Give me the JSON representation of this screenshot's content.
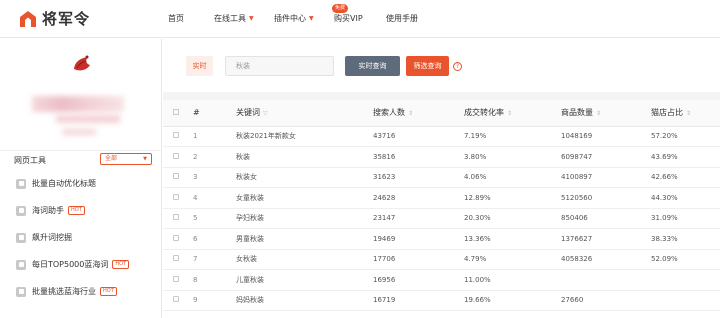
{
  "app": {
    "name": "将军令"
  },
  "nav": [
    {
      "label": "首页",
      "caret": false,
      "badge": ""
    },
    {
      "label": "在线工具",
      "caret": true,
      "badge": ""
    },
    {
      "label": "插件中心",
      "caret": true,
      "badge": "免费"
    },
    {
      "label": "购买VIP",
      "caret": false,
      "badge": ""
    },
    {
      "label": "使用手册",
      "caret": false,
      "badge": ""
    }
  ],
  "sidebar": {
    "tools_title": "网页工具",
    "tools_filter": "全部",
    "items": [
      {
        "label": "批量自动优化标题",
        "hot": ""
      },
      {
        "label": "海词助手",
        "hot": "HOT"
      },
      {
        "label": "飙升词挖掘",
        "hot": ""
      },
      {
        "label": "每日TOP5000蓝海词",
        "hot": "HOT"
      },
      {
        "label": "批量挑选蓝海行业",
        "hot": "HOT"
      }
    ]
  },
  "search": {
    "tab_label": "实时",
    "input_value": "秋装",
    "query_button": "实时查询",
    "filter_button": "筛选查询",
    "help_icon": "question-circle-icon"
  },
  "table": {
    "headers": [
      "#",
      "关键词",
      "搜索人数",
      "成交转化率",
      "商品数量",
      "猫店占比"
    ],
    "rows": [
      [
        "1",
        "秋装2021年新款女",
        "43716",
        "7.19%",
        "1048169",
        "57.20%"
      ],
      [
        "2",
        "秋装",
        "35816",
        "3.80%",
        "6098747",
        "43.69%"
      ],
      [
        "3",
        "秋装女",
        "31623",
        "4.06%",
        "4100897",
        "42.66%"
      ],
      [
        "4",
        "女童秋装",
        "24628",
        "12.89%",
        "5120560",
        "44.30%"
      ],
      [
        "5",
        "孕妇秋装",
        "23147",
        "20.30%",
        "850406",
        "31.09%"
      ],
      [
        "6",
        "男童秋装",
        "19469",
        "13.36%",
        "1376627",
        "38.33%"
      ],
      [
        "7",
        "女秋装",
        "17706",
        "4.79%",
        "4058326",
        "52.09%"
      ],
      [
        "8",
        "儿童秋装",
        "16956",
        "11.00%",
        "",
        ""
      ],
      [
        "9",
        "妈妈秋装",
        "16719",
        "19.66%",
        "27660",
        ""
      ]
    ]
  },
  "colors": {
    "accent": "#e9542c",
    "query_button": "#5d6b7a"
  }
}
